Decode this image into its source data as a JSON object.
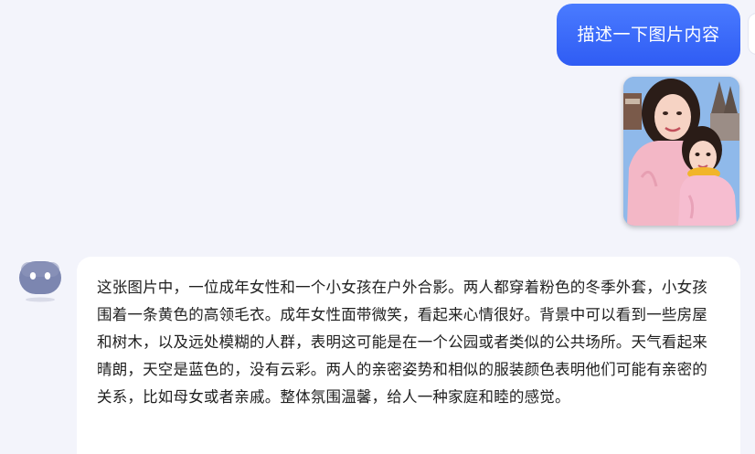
{
  "conversation": {
    "user_message": "描述一下图片内容",
    "bot_reply": "这张图片中，一位成年女性和一个小女孩在户外合影。两人都穿着粉色的冬季外套，小女孩围着一条黄色的高领毛衣。成年女性面带微笑，看起来心情很好。背景中可以看到一些房屋和树木，以及远处模糊的人群，表明这可能是在一个公园或者类似的公共场所。天气看起来晴朗，天空是蓝色的，没有云彩。两人的亲密姿势和相似的服装颜色表明他们可能有亲密的关系，比如母女或者亲戚。整体氛围温馨，给人一种家庭和睦的感觉。"
  },
  "colors": {
    "user_bubble": "#3566f7",
    "page_background": "#f3f4fb",
    "bot_bubble": "#ffffff",
    "bot_avatar": "#7c86b0"
  },
  "icons": {
    "bot_avatar": "robot-face-icon"
  }
}
